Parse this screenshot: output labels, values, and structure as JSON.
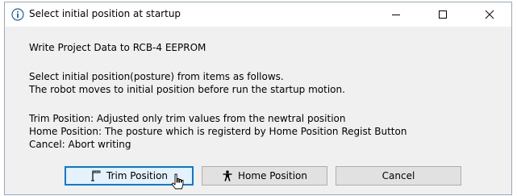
{
  "window": {
    "title": "Select initial position at startup",
    "info_icon": "info-icon",
    "controls": {
      "minimize": "minimize-icon",
      "maximize": "maximize-icon",
      "close": "close-icon"
    }
  },
  "content": {
    "line1": "Write Project Data to RCB-4 EEPROM",
    "line2": "Select initial position(posture) from items as follows.",
    "line3": "The robot moves to initial position before run the startup motion.",
    "line4": "Trim Position: Adjusted only trim values from the newtral position",
    "line5": "Home Position: The posture which is registerd by Home Position Regist Button",
    "line6": "Cancel: Abort writing"
  },
  "buttons": {
    "trim": "Trim Position",
    "home": "Home Position",
    "cancel": "Cancel"
  },
  "colors": {
    "accent": "#0078d7",
    "dialog_bg": "#f0f0f0",
    "button_bg": "#e1e1e1"
  }
}
